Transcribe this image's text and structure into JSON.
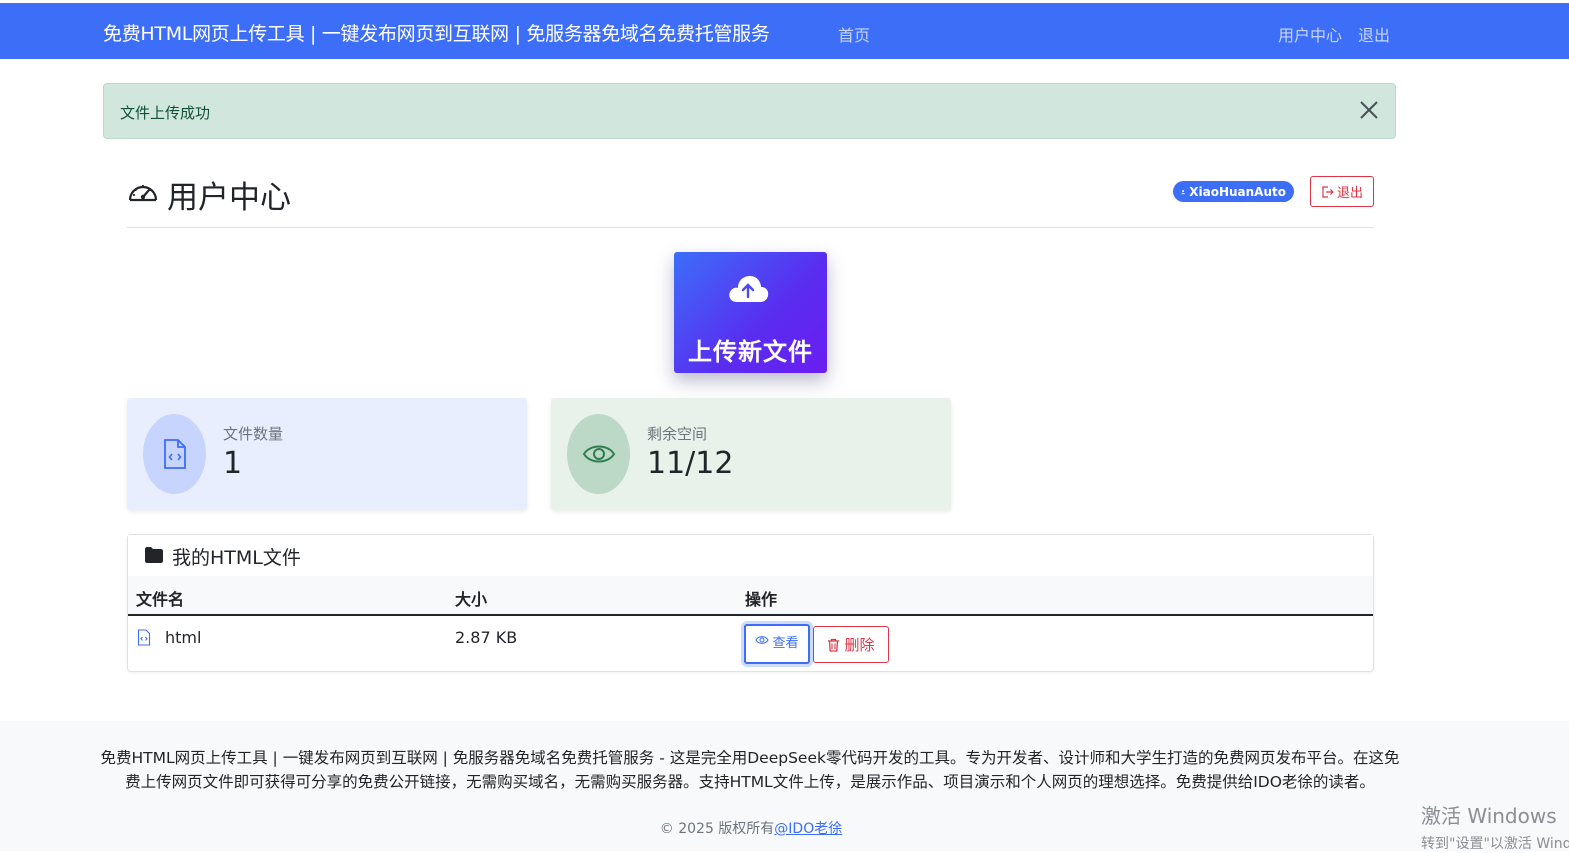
{
  "navbar": {
    "brand": "免费HTML网页上传工具 | 一键发布网页到互联网 | 免服务器免域名免费托管服务",
    "home": "首页",
    "user_center": "用户中心",
    "logout": "退出"
  },
  "alert": {
    "message": "文件上传成功"
  },
  "page": {
    "title": "用户中心",
    "username": "XiaoHuanAuto",
    "logout_button": "退出"
  },
  "upload": {
    "label": "上传新文件"
  },
  "stats": {
    "file_count_label": "文件数量",
    "file_count_value": "1",
    "space_label": "剩余空间",
    "space_value": "11/12"
  },
  "files": {
    "title": "我的HTML文件",
    "columns": [
      "文件名",
      "大小",
      "操作"
    ],
    "rows": [
      {
        "name": "html",
        "size": "2.87 KB",
        "view": "查看",
        "delete": "删除"
      }
    ]
  },
  "footer": {
    "description": "免费HTML网页上传工具 | 一键发布网页到互联网 | 免服务器免域名免费托管服务 - 这是完全用DeepSeek零代码开发的工具。专为开发者、设计师和大学生打造的免费网页发布平台。在这免费上传网页文件即可获得可分享的免费公开链接，无需购买域名，无需购买服务器。支持HTML文件上传，是展示作品、项目演示和个人网页的理想选择。免费提供给IDO老徐的读者。",
    "copyright": "© 2025 版权所有",
    "author_link": "@IDO老徐"
  },
  "watermark": {
    "line1": "激活 Windows",
    "line2": "转到\"设置\"以激活 Windows。"
  },
  "colors": {
    "primary": "#3d6ef8",
    "danger": "#dc3545",
    "success_bg": "#d1e7dd"
  }
}
